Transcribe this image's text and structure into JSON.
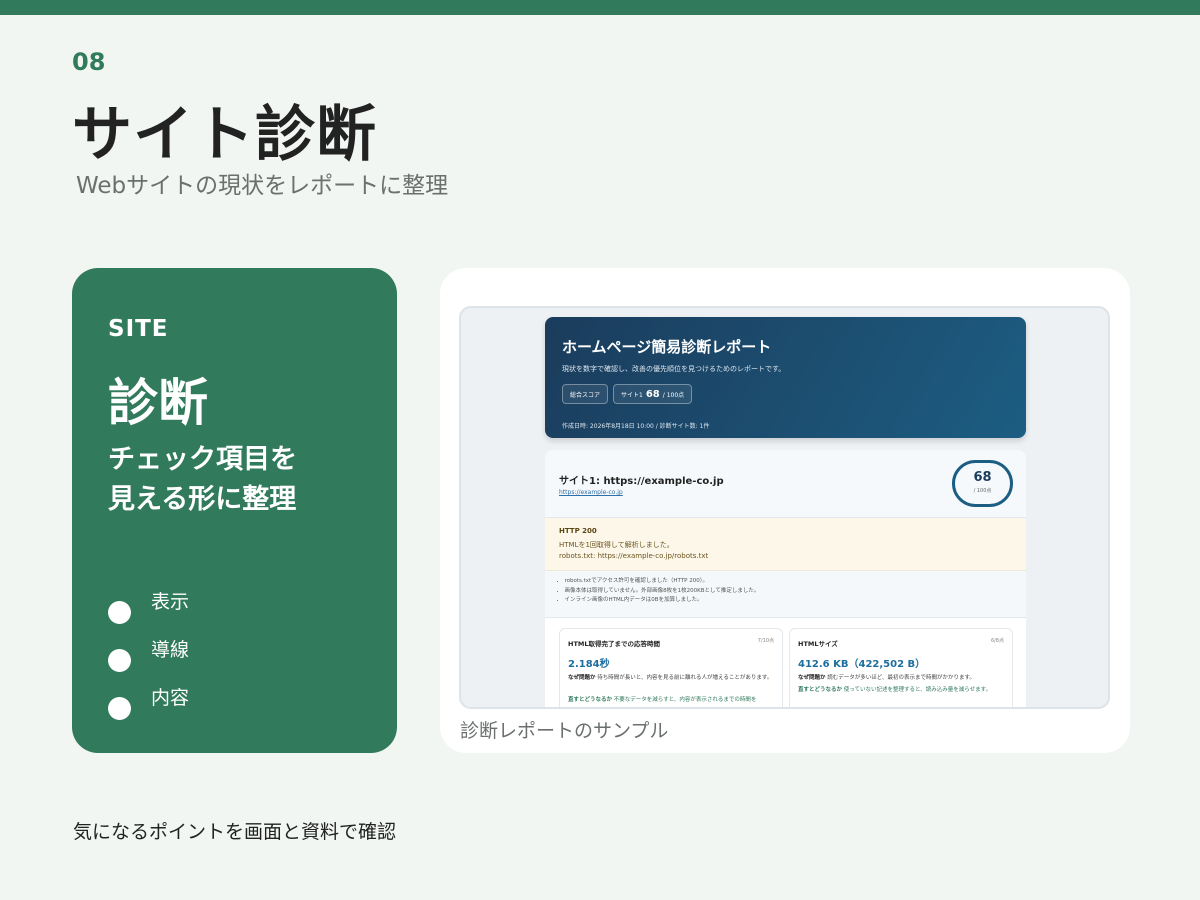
{
  "slide": {
    "number": "08",
    "title": "サイト診断",
    "subtitle": "Webサイトの現状をレポートに整理"
  },
  "colors": {
    "accent": "#317a5c",
    "report_navy": "#1b3c5c"
  },
  "card": {
    "label": "SITE",
    "title": "診断",
    "desc_line1": "チェック項目を",
    "desc_line2": "見える形に整理",
    "items": [
      {
        "label": "表示"
      },
      {
        "label": "導線"
      },
      {
        "label": "内容"
      }
    ]
  },
  "preview": {
    "caption": "診断レポートのサンプル",
    "report": {
      "title": "ホームページ簡易診断レポート",
      "subtitle": "現状を数字で確認し、改善の優先順位を見つけるためのレポートです。",
      "badge_total_label": "総合スコア",
      "badge_site_label": "サイト1",
      "badge_site_score": "68",
      "badge_site_unit": "/ 100点",
      "created": "作成日時: 2026年8月18日 10:00 / 診断サイト数: 1件",
      "site": {
        "title": "サイト1: https://example-co.jp",
        "link": "https://example-co.jp",
        "score": "68",
        "score_unit": "/ 100点"
      },
      "http": {
        "status": "HTTP 200",
        "line1": "HTMLを1回取得して解析しました。",
        "line2": "robots.txt: https://example-co.jp/robots.txt"
      },
      "notes": [
        "robots.txtでアクセス許可を確認しました（HTTP 200）。",
        "画像本体は取得していません。外部画像8枚を1枚200KBとして推定しました。",
        "インライン画像のHTML内データは0Bを加算しました。"
      ],
      "metrics": [
        {
          "title": "HTML取得完了までの応答時間",
          "score": "7/10点",
          "value": "2.184秒",
          "why_label": "なぜ問題か",
          "why_text": "待ち時間が長いと、内容を見る前に離れる人が増えることがあります。",
          "fix_label": "直すとどうなるか",
          "fix_text": "不要なデータを減らすと、内容が表示されるまでの時間を"
        },
        {
          "title": "HTMLサイズ",
          "score": "6/8点",
          "value": "412.6 KB（422,502 B）",
          "why_label": "なぜ問題か",
          "why_text": "読むデータが多いほど、最初の表示まで時間がかかります。",
          "fix_label": "直すとどうなるか",
          "fix_text": "使っていない記述を整理すると、読み込み量を減らせます。"
        }
      ]
    }
  },
  "footer": "気になるポイントを画面と資料で確認"
}
